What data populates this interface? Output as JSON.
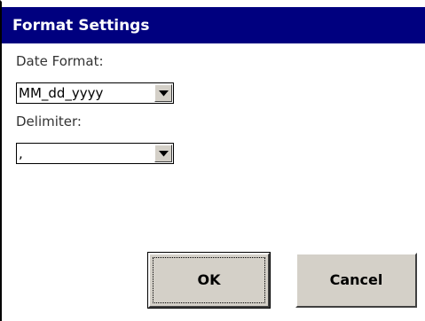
{
  "dialog": {
    "title": "Format Settings",
    "date_format": {
      "label": "Date Format:",
      "value": "MM_dd_yyyy"
    },
    "delimiter": {
      "label": "Delimiter:",
      "value": ","
    },
    "buttons": {
      "ok": "OK",
      "cancel": "Cancel"
    }
  },
  "colors": {
    "title_bar": "#00007f",
    "button_face": "#d4d0c8"
  }
}
